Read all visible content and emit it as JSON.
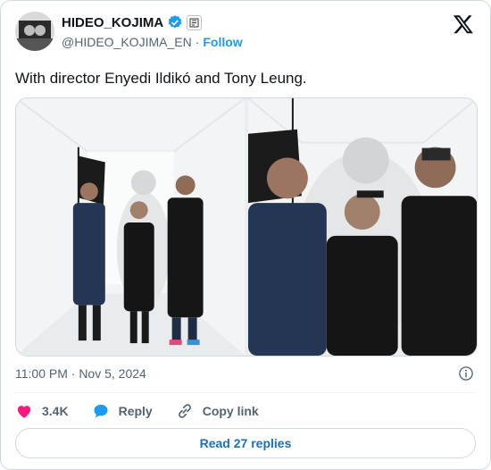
{
  "author": {
    "display_name": "HIDEO_KOJIMA",
    "handle": "@HIDEO_KOJIMA_EN",
    "separator": "·",
    "follow_label": "Follow"
  },
  "tweet": {
    "text": "With director Enyedi Ildikó and Tony Leung.",
    "timestamp": "11:00 PM · Nov 5, 2024"
  },
  "actions": {
    "likes": "3.4K",
    "reply_label": "Reply",
    "copy_link_label": "Copy link"
  },
  "read_replies_label": "Read 27 replies",
  "colors": {
    "brand_blue": "#1d9bf0",
    "like_red": "#f91880",
    "text_secondary": "#536471",
    "border": "#cfd9de"
  },
  "icons": [
    "verified-badge-icon",
    "affiliate-badge-icon",
    "x-logo-icon",
    "info-icon",
    "heart-icon",
    "reply-bubble-icon",
    "link-icon"
  ]
}
